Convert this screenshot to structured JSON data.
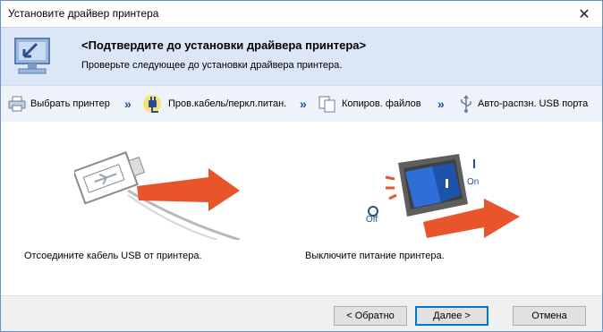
{
  "window": {
    "title": "Установите драйвер принтера",
    "close_glyph": "✕"
  },
  "header": {
    "title": "<Подтвердите до установки драйвера принтера>",
    "subtitle": "Проверьте следующее до установки драйвера принтера.",
    "icon": "monitor-install-icon"
  },
  "steps": [
    {
      "label": "Выбрать принтер",
      "icon": "printer-icon"
    },
    {
      "label": "Пров.кабель/перкл.питан.",
      "icon": "plug-icon",
      "active": true
    },
    {
      "label": "Копиров. файлов",
      "icon": "copy-files-icon"
    },
    {
      "label": "Авто-распзн. USB порта",
      "icon": "usb-icon"
    }
  ],
  "step_separator": "»",
  "instructions": {
    "usb": "Отсоедините кабель USB от принтера.",
    "power": "Выключите питание принтера.",
    "switch_on_label": "On",
    "switch_off_label": "Off"
  },
  "footer": {
    "back_label": "< Обратно",
    "next_label": "Далее >",
    "cancel_label": "Отмена"
  },
  "colors": {
    "accent": "#1a4f9c",
    "arrow_orange": "#e8552a",
    "header_bg": "#dbe7f7"
  }
}
